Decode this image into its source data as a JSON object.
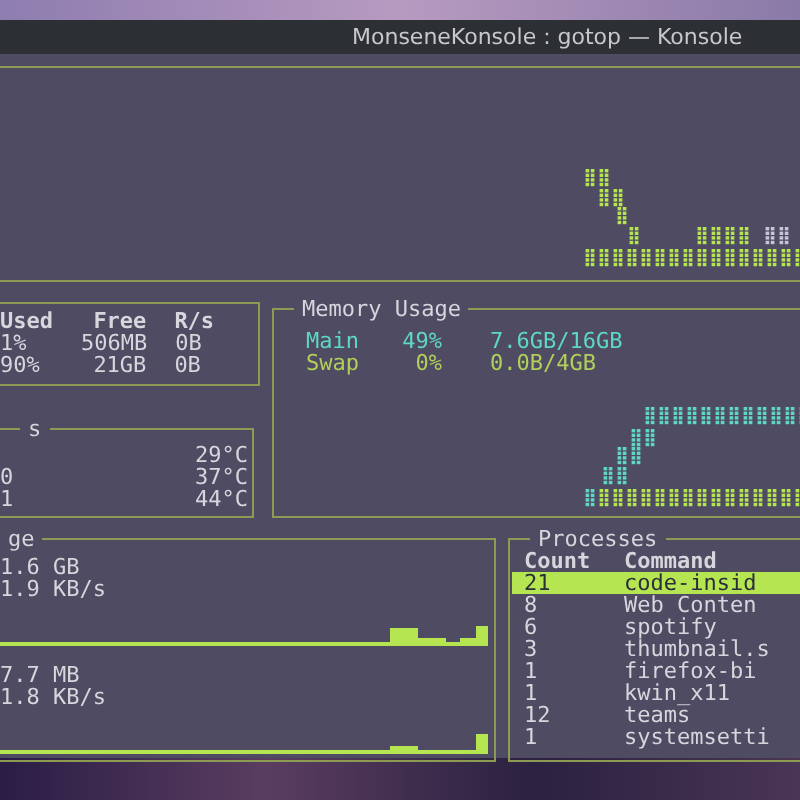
{
  "window": {
    "title": "MonseneKonsole : gotop — Konsole"
  },
  "disk": {
    "columns": [
      "Used",
      "Free",
      "R/s"
    ],
    "rows": [
      [
        "1%",
        "506MB",
        "0B"
      ],
      [
        "90%",
        "21GB",
        "0B"
      ]
    ]
  },
  "temperatures": {
    "title": "s",
    "rows": [
      {
        "value": "29°C"
      },
      {
        "label": "0",
        "value": "37°C"
      },
      {
        "label": "1",
        "value": "44°C"
      }
    ]
  },
  "memory": {
    "title": "Memory Usage",
    "rows": [
      {
        "name": "Main",
        "percent": "49%",
        "amount": "7.6GB/16GB",
        "color": "#5fd7c7"
      },
      {
        "name": "Swap",
        "percent": "0%",
        "amount": "0.0B/4GB",
        "color": "#b0d05a"
      }
    ]
  },
  "network": {
    "title": "ge",
    "rows": [
      {
        "total": "1.6 GB",
        "rate": "1.9 KB/s"
      },
      {
        "total": "7.7 MB",
        "rate": "1.8 KB/s"
      }
    ]
  },
  "processes": {
    "title": "Processes",
    "columns": [
      "Count",
      "Command"
    ],
    "rows": [
      {
        "count": "21",
        "command": "code-insid",
        "selected": true
      },
      {
        "count": "8",
        "command": "Web Conten",
        "selected": false
      },
      {
        "count": "6",
        "command": "spotify",
        "selected": false
      },
      {
        "count": "3",
        "command": "thumbnail.s",
        "selected": false
      },
      {
        "count": "1",
        "command": "firefox-bi",
        "selected": false
      },
      {
        "count": "1",
        "command": "kwin_x11",
        "selected": false
      },
      {
        "count": "12",
        "command": "teams",
        "selected": false
      },
      {
        "count": "1",
        "command": "systemsetti",
        "selected": false
      }
    ]
  }
}
